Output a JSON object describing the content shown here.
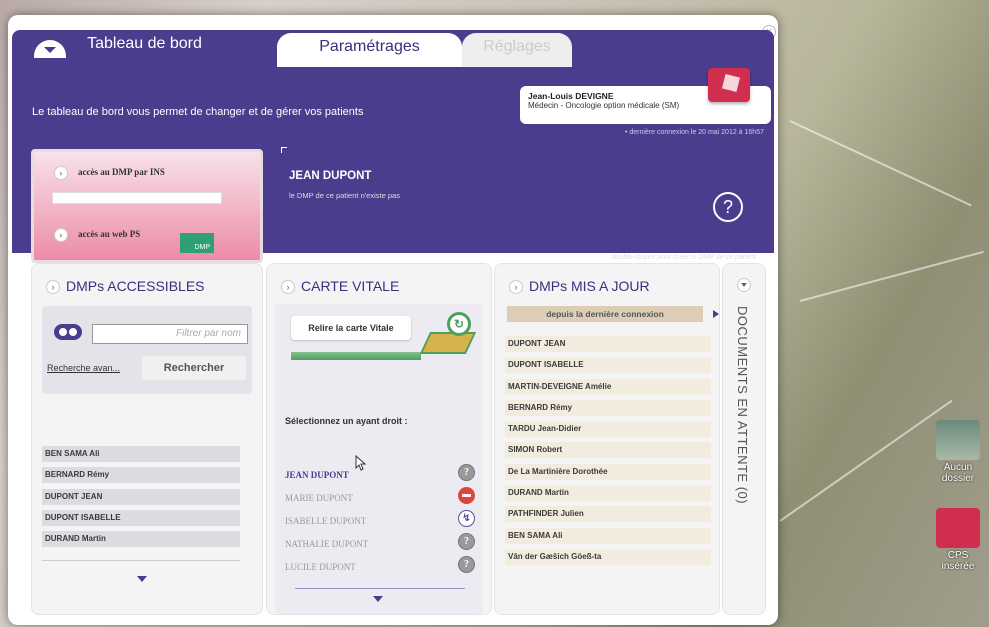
{
  "header": {
    "tabs": [
      {
        "label": "Tableau de bord"
      },
      {
        "label": "Paramétrages"
      },
      {
        "label": "Réglages"
      }
    ],
    "intro": "Le tableau de bord vous permet de changer et de gérer vos patients",
    "user": {
      "name": "Jean-Louis DEVIGNE",
      "role": "Médecin - Oncologie option médicale (SM)",
      "last_connection": "• dernière connexion le 20 mai 2012 à 16h57"
    },
    "access": {
      "dmp_ins": "accès au DMP par INS",
      "web_ps": "accès au web PS",
      "dmp_logo": "DMP"
    },
    "patient": {
      "name": "JEAN DUPONT",
      "message": "le DMP de ce patient n'existe pas",
      "help": "?",
      "double_click": "double-cliquer pour créer le DMP de ce patient"
    }
  },
  "panels": {
    "accessible": {
      "title": "DMPs ACCESSIBLES",
      "filter_placeholder": "Filtrer par nom",
      "advanced_link": "Recherche avan...",
      "search_button": "Rechercher",
      "patients": [
        "BEN SAMA Ali",
        "BERNARD Rémy",
        "DUPONT JEAN",
        "DUPONT ISABELLE",
        "DURAND Martin"
      ]
    },
    "vitale": {
      "title": "CARTE VITALE",
      "reread_button": "Relire la carte Vitale",
      "select_label": "Sélectionnez un ayant droit :",
      "beneficiaries": [
        {
          "name": "JEAN DUPONT",
          "status": "unknown",
          "selected": true
        },
        {
          "name": "MARIE DUPONT",
          "status": "none"
        },
        {
          "name": "ISABELLE DUPONT",
          "status": "ok"
        },
        {
          "name": "NATHALIE DUPONT",
          "status": "unknown"
        },
        {
          "name": "LUCILE DUPONT",
          "status": "unknown"
        }
      ]
    },
    "updated": {
      "title": "DMPs MIS A JOUR",
      "since": "depuis la dernière connexion",
      "patients": [
        "DUPONT JEAN",
        "DUPONT ISABELLE",
        "MARTIN-DEVEIGNE Amélie",
        "BERNARD Rémy",
        "TARDU Jean-Didier",
        "SIMON Robert",
        "De La Martinière Dorothée",
        "DURAND Martin",
        "PATHFINDER Julien",
        "BEN SAMA Ali",
        "Vân der Gæšich Göeß-ta"
      ]
    },
    "pending": {
      "title": "DOCUMENTS EN ATTENTE (0)"
    }
  },
  "desktop": {
    "icons": [
      {
        "label": "Aucun dossier"
      },
      {
        "label": "CPS insérée"
      }
    ]
  },
  "colors": {
    "header": "#4c3c8e",
    "accent": "#e0443a",
    "green": "#4e9f5e"
  }
}
